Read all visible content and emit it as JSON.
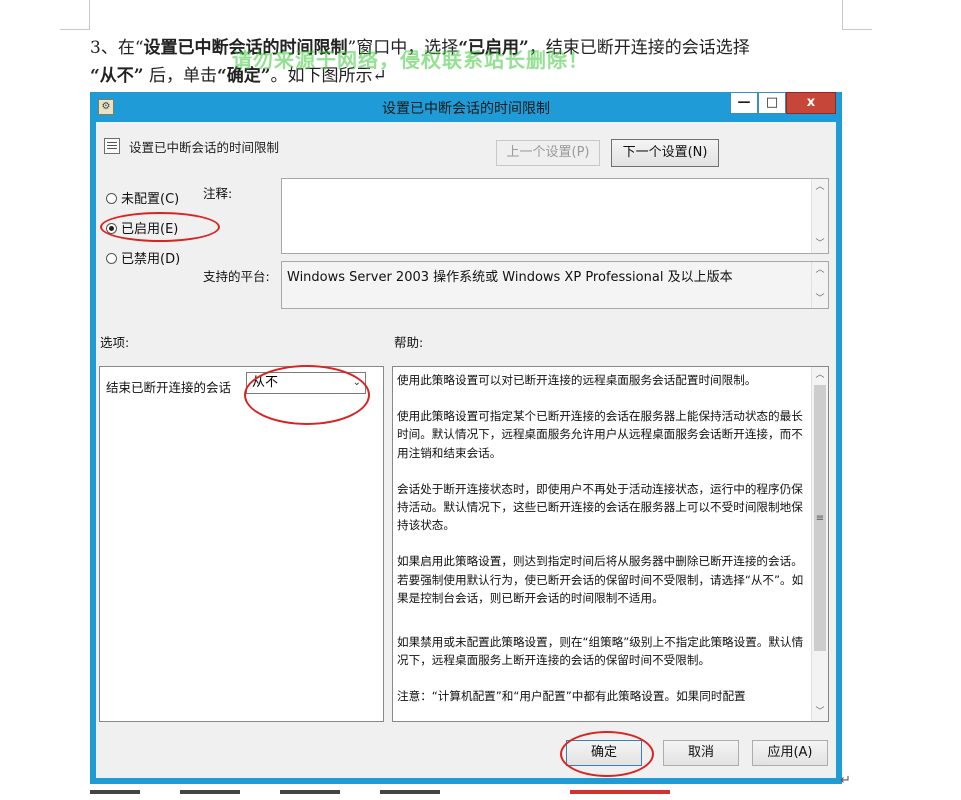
{
  "document": {
    "instruction_prefix": "3、在",
    "q_open": "“",
    "policy_name": "设置已中断会话的时间限制",
    "q_close": "”",
    "instruction_mid1": "窗口中，选择",
    "enabled_option": "“已启用”",
    "instruction_mid2": "，结束已断开连接的会话选择",
    "never_option": "“从不”",
    "instruction_mid3": " 后，单击",
    "ok_option": "“确定”",
    "instruction_suffix": "。如下图所示",
    "return_mark": "↵"
  },
  "watermark": "请勿来源于网络，侵权联系站长删除！",
  "window": {
    "title": "设置已中断会话的时间限制",
    "minimize_label": "—",
    "maximize_label": "□",
    "close_label": "x",
    "header_title": "设置已中断会话的时间限制",
    "prev_button": "上一个设置(P)",
    "next_button": "下一个设置(N)",
    "radio_not_configured": "未配置(C)",
    "radio_enabled": "已启用(E)",
    "radio_disabled": "已禁用(D)",
    "comment_label": "注释:",
    "platform_label": "支持的平台:",
    "platform_value": "Windows Server 2003 操作系统或 Windows XP Professional 及以上版本",
    "options_label": "选项:",
    "help_label": "帮助:",
    "option_end_session_label": "结束已断开连接的会话",
    "option_end_session_value": "从不",
    "help_paragraphs": [
      "使用此策略设置可以对已断开连接的远程桌面服务会话配置时间限制。",
      "使用此策略设置可指定某个已断开连接的会话在服务器上能保持活动状态的最长时间。默认情况下，远程桌面服务允许用户从远程桌面服务会话断开连接，而不用注销和结束会话。",
      "会话处于断开连接状态时，即使用户不再处于活动连接状态，运行中的程序仍保持活动。默认情况下，这些已断开连接的会话在服务器上可以不受时间限制地保持该状态。",
      "如果启用此策略设置，则达到指定时间后将从服务器中删除已断开连接的会话。若要强制使用默认行为，使已断开会话的保留时间不受限制，请选择“从不”。如果是控制台会话，则已断开会话的时间限制不适用。",
      "如果禁用或未配置此策略设置，则在“组策略”级别上不指定此策略设置。默认情况下，远程桌面服务上断开连接的会话的保留时间不受限制。",
      "注意：“计算机配置”和“用户配置”中都有此策略设置。如果同时配置"
    ],
    "ok_button": "确定",
    "cancel_button": "取消",
    "apply_button": "应用(A)",
    "scroll_grip": "≡"
  },
  "colors": {
    "title_bar": "#1f9bd8",
    "close_button": "#c7463a",
    "annotation": "#d92323",
    "watermark": "#3cc83c"
  }
}
